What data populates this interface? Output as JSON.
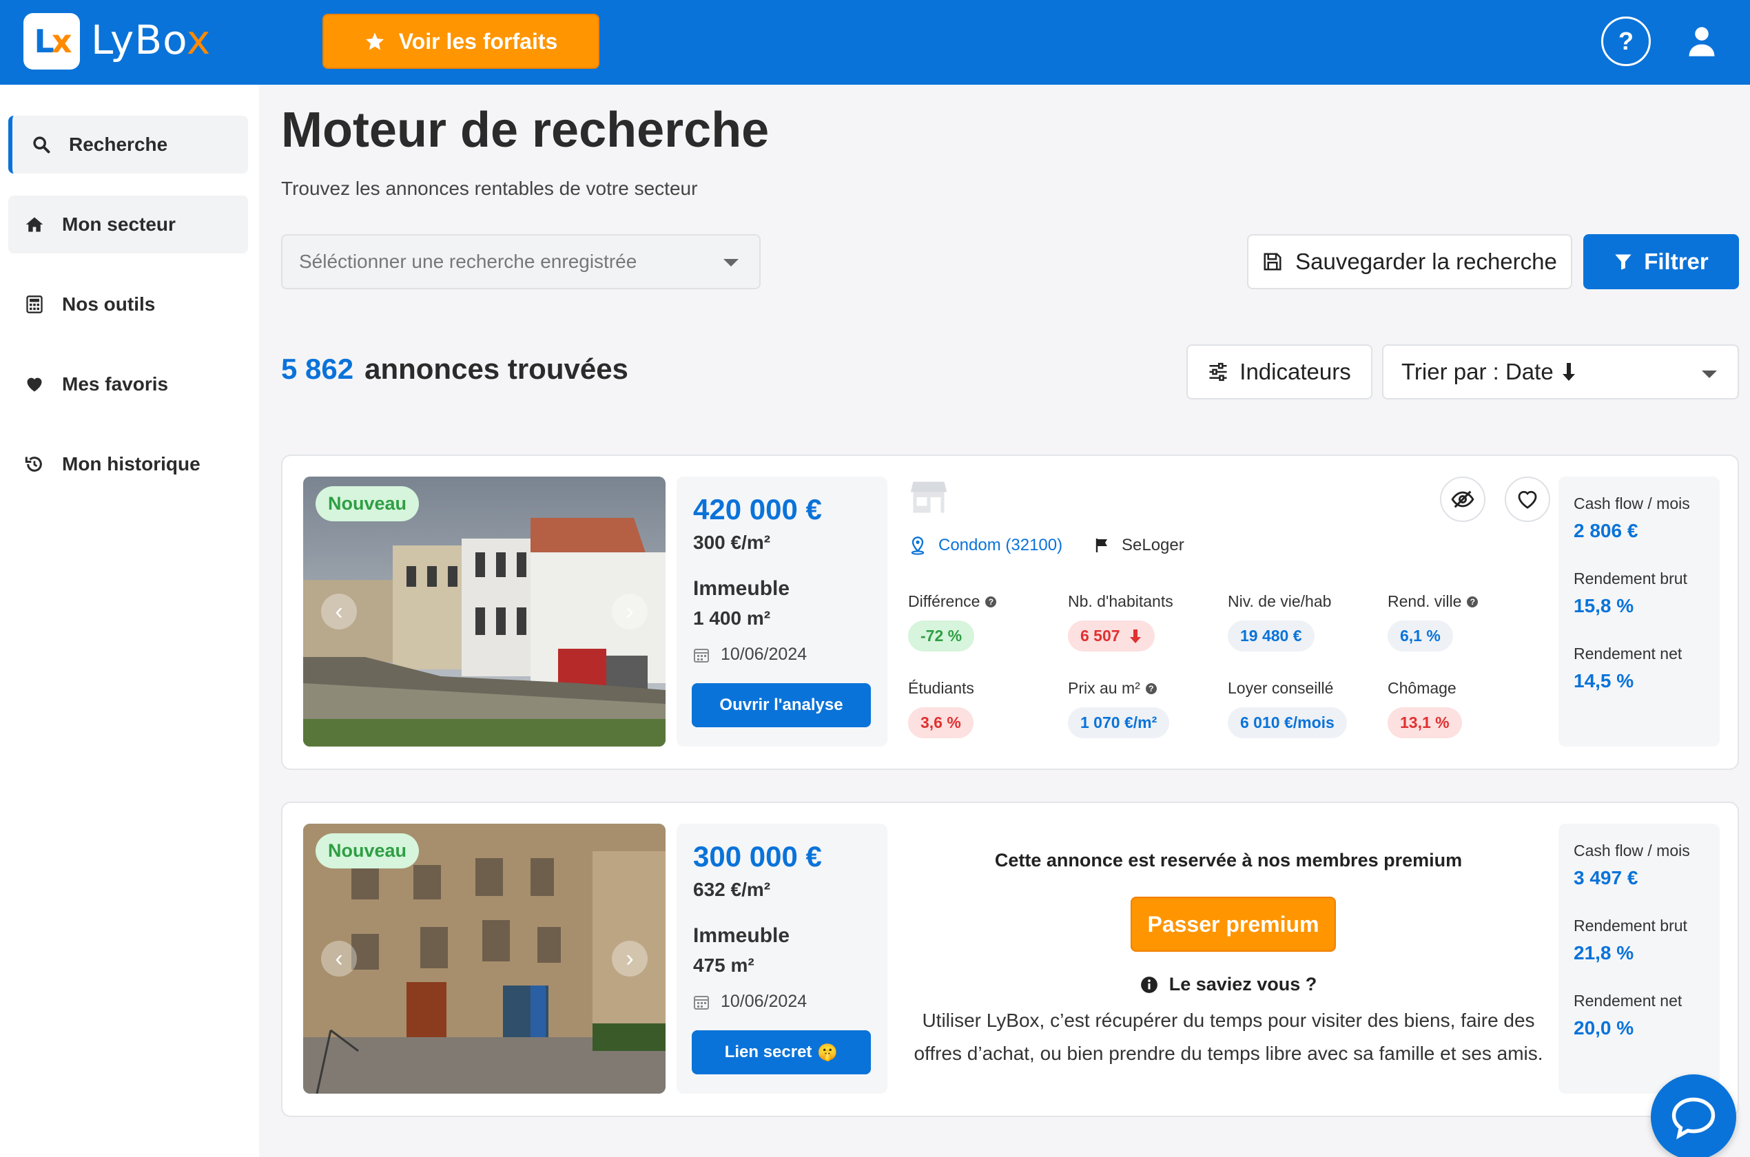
{
  "brand": {
    "name": "LyBox",
    "name_main": "LyBo",
    "name_accent": "x",
    "logo_mark": "L",
    "logo_mark_accent": "x"
  },
  "header": {
    "plans_label": "Voir les forfaits",
    "help_label": "?"
  },
  "colors": {
    "primary": "#0a73d9",
    "accent": "#ff9500",
    "positive": "#2f9e44",
    "negative": "#e03131"
  },
  "sidebar": {
    "items": [
      {
        "label": "Recherche",
        "icon": "search-icon"
      },
      {
        "label": "Mon secteur",
        "icon": "home-icon"
      },
      {
        "label": "Nos outils",
        "icon": "calculator-icon"
      },
      {
        "label": "Mes favoris",
        "icon": "heart-icon"
      },
      {
        "label": "Mon historique",
        "icon": "history-icon"
      }
    ]
  },
  "main": {
    "title": "Moteur de recherche",
    "subtitle": "Trouvez les annonces rentables de votre secteur",
    "saved_search_placeholder": "Séléctionner une recherche enregistrée",
    "save_label": "Sauvegarder la recherche",
    "filter_label": "Filtrer",
    "results_count": "5 862",
    "results_label": "annonces trouvées",
    "indicators_label": "Indicateurs",
    "sort_label": "Trier par : Date"
  },
  "listings": [
    {
      "badge": "Nouveau",
      "price": "420 000 €",
      "price_per_m2": "300 €/m²",
      "type": "Immeuble",
      "area": "1 400 m²",
      "date": "10/06/2024",
      "action_label": "Ouvrir l'analyse",
      "location": "Condom (32100)",
      "source": "SeLoger",
      "indicators": [
        {
          "label": "Différence",
          "value": "-72 %",
          "tone": "green",
          "help": "?"
        },
        {
          "label": "Nb. d'habitants",
          "value": "6 507",
          "tone": "red",
          "trend": "down"
        },
        {
          "label": "Niv. de vie/hab",
          "value": "19 480 €",
          "tone": "blue"
        },
        {
          "label": "Rend. ville",
          "value": "6,1 %",
          "tone": "blue",
          "help": "?"
        },
        {
          "label": "Étudiants",
          "value": "3,6 %",
          "tone": "red"
        },
        {
          "label": "Prix au m²",
          "value": "1 070 €/m²",
          "tone": "blue",
          "help": "?"
        },
        {
          "label": "Loyer conseillé",
          "value": "6 010 €/mois",
          "tone": "blue"
        },
        {
          "label": "Chômage",
          "value": "13,1 %",
          "tone": "red"
        }
      ],
      "stats": [
        {
          "label": "Cash flow / mois",
          "value": "2 806 €"
        },
        {
          "label": "Rendement brut",
          "value": "15,8 %"
        },
        {
          "label": "Rendement net",
          "value": "14,5 %"
        }
      ]
    },
    {
      "badge": "Nouveau",
      "price": "300 000 €",
      "price_per_m2": "632 €/m²",
      "type": "Immeuble",
      "area": "475 m²",
      "date": "10/06/2024",
      "action_label": "Lien secret",
      "action_emoji": "🤫",
      "premium_title": "Cette annonce est reservée à nos membres premium",
      "premium_button": "Passer premium",
      "tip_title": "Le saviez vous ?",
      "tip_text": "Utiliser LyBox, c’est récupérer du temps pour visiter des biens, faire des offres d’achat, ou bien prendre du temps libre avec sa famille et ses amis.",
      "stats": [
        {
          "label": "Cash flow / mois",
          "value": "3 497 €"
        },
        {
          "label": "Rendement brut",
          "value": "21,8 %"
        },
        {
          "label": "Rendement net",
          "value": "20,0 %"
        }
      ]
    }
  ]
}
